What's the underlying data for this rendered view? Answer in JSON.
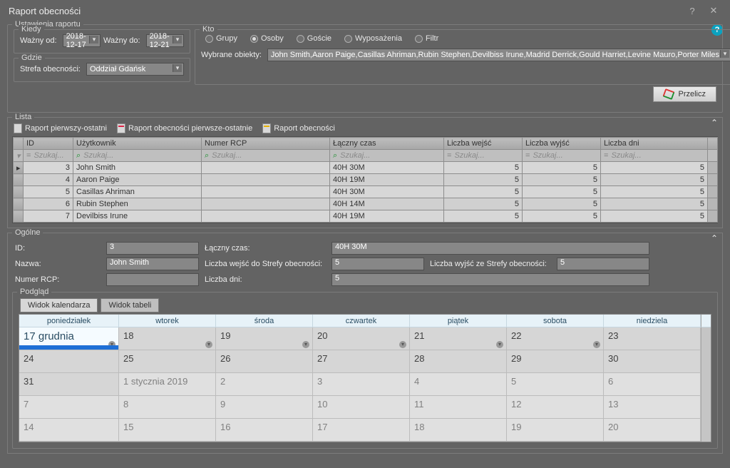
{
  "window": {
    "title": "Raport obecności"
  },
  "settings": {
    "legend": "Ustawienia raportu",
    "kiedy": {
      "legend": "Kiedy",
      "from_label": "Ważny od:",
      "from": "2018-12-17",
      "to_label": "Ważny do:",
      "to": "2018-12-21"
    },
    "gdzie": {
      "legend": "Gdzie",
      "zone_label": "Strefa obecności:",
      "zone": "Oddział Gdańsk"
    },
    "kto": {
      "legend": "Kto",
      "options": {
        "grupy": "Grupy",
        "osoby": "Osoby",
        "goscie": "Goście",
        "wyposazenia": "Wyposażenia",
        "filtr": "Filtr"
      },
      "selected": "osoby",
      "objects_label": "Wybrane obiekty:",
      "objects": "John Smith,Aaron Paige,Casillas Ahriman,Rubin Stephen,Devilbiss Irune,Madrid Derrick,Gould Harriet,Levine Mauro,Porter Miles"
    },
    "recalc": "Przelicz"
  },
  "list": {
    "legend": "Lista",
    "reports": {
      "r1": "Raport pierwszy-ostatni",
      "r2": "Raport obecności pierwsze-ostatnie",
      "r3": "Raport obecności"
    },
    "columns": {
      "id": "ID",
      "user": "Użytkownik",
      "rcp": "Numer RCP",
      "time": "Łączny czas",
      "in": "Liczba wejść",
      "out": "Liczba wyjść",
      "days": "Liczba dni"
    },
    "filter_placeholder": "Szukaj...",
    "rows": [
      {
        "id": "3",
        "user": "John Smith",
        "rcp": "",
        "time": "40H 30M",
        "in": "5",
        "out": "5",
        "days": "5"
      },
      {
        "id": "4",
        "user": "Aaron Paige",
        "rcp": "",
        "time": "40H 19M",
        "in": "5",
        "out": "5",
        "days": "5"
      },
      {
        "id": "5",
        "user": "Casillas Ahriman",
        "rcp": "",
        "time": "40H 30M",
        "in": "5",
        "out": "5",
        "days": "5"
      },
      {
        "id": "6",
        "user": "Rubin Stephen",
        "rcp": "",
        "time": "40H 14M",
        "in": "5",
        "out": "5",
        "days": "5"
      },
      {
        "id": "7",
        "user": "Devilbiss Irune",
        "rcp": "",
        "time": "40H 19M",
        "in": "5",
        "out": "5",
        "days": "5"
      }
    ]
  },
  "general": {
    "legend": "Ogólne",
    "id_label": "ID:",
    "id": "3",
    "time_label": "Łączny czas:",
    "time": "40H 30M",
    "name_label": "Nazwa:",
    "name": "John Smith",
    "in_label": "Liczba wejść do Strefy obecności:",
    "in": "5",
    "out_label": "Liczba wyjść ze Strefy obecności:",
    "out": "5",
    "rcp_label": "Numer RCP:",
    "rcp": "",
    "days_label": "Liczba dni:",
    "days": "5"
  },
  "preview": {
    "legend": "Podgląd",
    "tabs": {
      "cal": "Widok kalendarza",
      "tbl": "Widok tabeli"
    },
    "dow": [
      "poniedziałek",
      "wtorek",
      "środa",
      "czwartek",
      "piątek",
      "sobota",
      "niedziela"
    ],
    "weeks": [
      [
        {
          "t": "17 grudnia",
          "hl": true,
          "bar": true,
          "chev": true
        },
        {
          "t": "18",
          "chev": true
        },
        {
          "t": "19",
          "chev": true
        },
        {
          "t": "20",
          "chev": true
        },
        {
          "t": "21",
          "chev": true
        },
        {
          "t": "22",
          "chev": true
        },
        {
          "t": "23"
        }
      ],
      [
        {
          "t": "24"
        },
        {
          "t": "25"
        },
        {
          "t": "26"
        },
        {
          "t": "27"
        },
        {
          "t": "28"
        },
        {
          "t": "29"
        },
        {
          "t": "30"
        }
      ],
      [
        {
          "t": "31"
        },
        {
          "t": "1 stycznia 2019",
          "other": true
        },
        {
          "t": "2",
          "other": true
        },
        {
          "t": "3",
          "other": true
        },
        {
          "t": "4",
          "other": true
        },
        {
          "t": "5",
          "other": true
        },
        {
          "t": "6",
          "other": true
        }
      ],
      [
        {
          "t": "7",
          "other": true
        },
        {
          "t": "8",
          "other": true
        },
        {
          "t": "9",
          "other": true
        },
        {
          "t": "10",
          "other": true
        },
        {
          "t": "11",
          "other": true
        },
        {
          "t": "12",
          "other": true
        },
        {
          "t": "13",
          "other": true
        }
      ],
      [
        {
          "t": "14",
          "other": true
        },
        {
          "t": "15",
          "other": true
        },
        {
          "t": "16",
          "other": true
        },
        {
          "t": "17",
          "other": true
        },
        {
          "t": "18",
          "other": true
        },
        {
          "t": "19",
          "other": true
        },
        {
          "t": "20",
          "other": true
        }
      ]
    ]
  }
}
